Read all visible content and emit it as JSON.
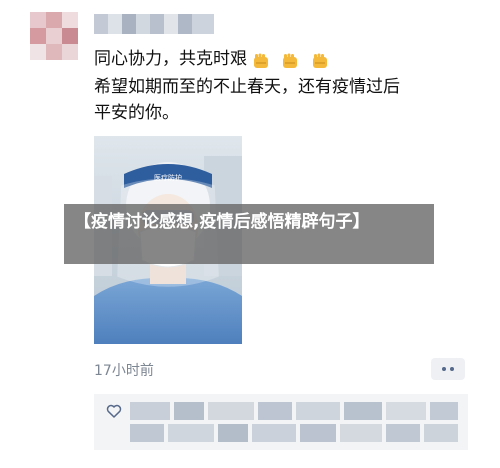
{
  "post": {
    "lines": [
      "同心协力，共克时艰",
      "希望如期而至的不止春天，还有疫情过后",
      "平安的你。"
    ],
    "emoji_count": 3,
    "emoji_name": "fist-emoji",
    "time": "17小时前"
  },
  "overlay": {
    "title": "【疫情讨论感想,疫情后感悟精辟句子】"
  },
  "colors": {
    "banner_bg": "#646464",
    "timestamp": "#7d8693",
    "likes_bg": "#f3f4f6",
    "more_dots": "#56698a"
  },
  "icons": {
    "like": "heart-icon",
    "more": "more-dots-icon"
  }
}
